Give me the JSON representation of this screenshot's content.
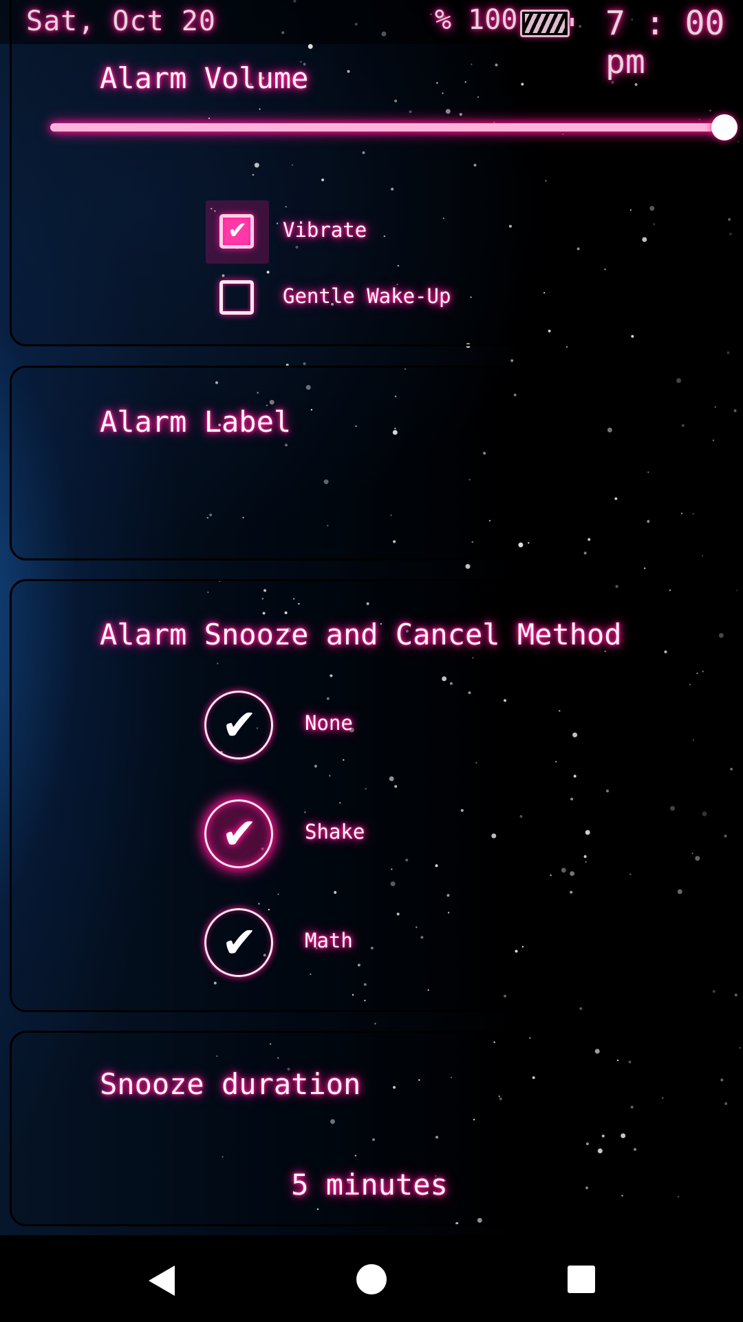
{
  "status_bar": {
    "date": "Sat, Oct 20",
    "battery_text": "% 100",
    "battery_icon": "battery-charging-icon",
    "time": "7 : 00 pm"
  },
  "alarm_volume": {
    "title": "Alarm Volume",
    "volume_level": 1.0,
    "options": [
      {
        "label": "Vibrate",
        "checked": true
      },
      {
        "label": "Gentle Wake-Up",
        "checked": false
      }
    ]
  },
  "alarm_label": {
    "title": "Alarm Label"
  },
  "snooze_cancel": {
    "title": "Alarm Snooze and Cancel Method",
    "options": [
      {
        "label": "None",
        "selected": false
      },
      {
        "label": "Shake",
        "selected": true
      },
      {
        "label": "Math",
        "selected": false
      }
    ]
  },
  "snooze_duration": {
    "title": "Snooze duration",
    "value": "5 minutes"
  },
  "nav": {
    "back_icon": "back-triangle-icon",
    "home_icon": "home-circle-icon",
    "recents_icon": "recents-square-icon"
  },
  "colors": {
    "accent": "#ff1493",
    "accent_light": "#ff3aa8",
    "text": "#ffffff",
    "background": "#000000"
  }
}
